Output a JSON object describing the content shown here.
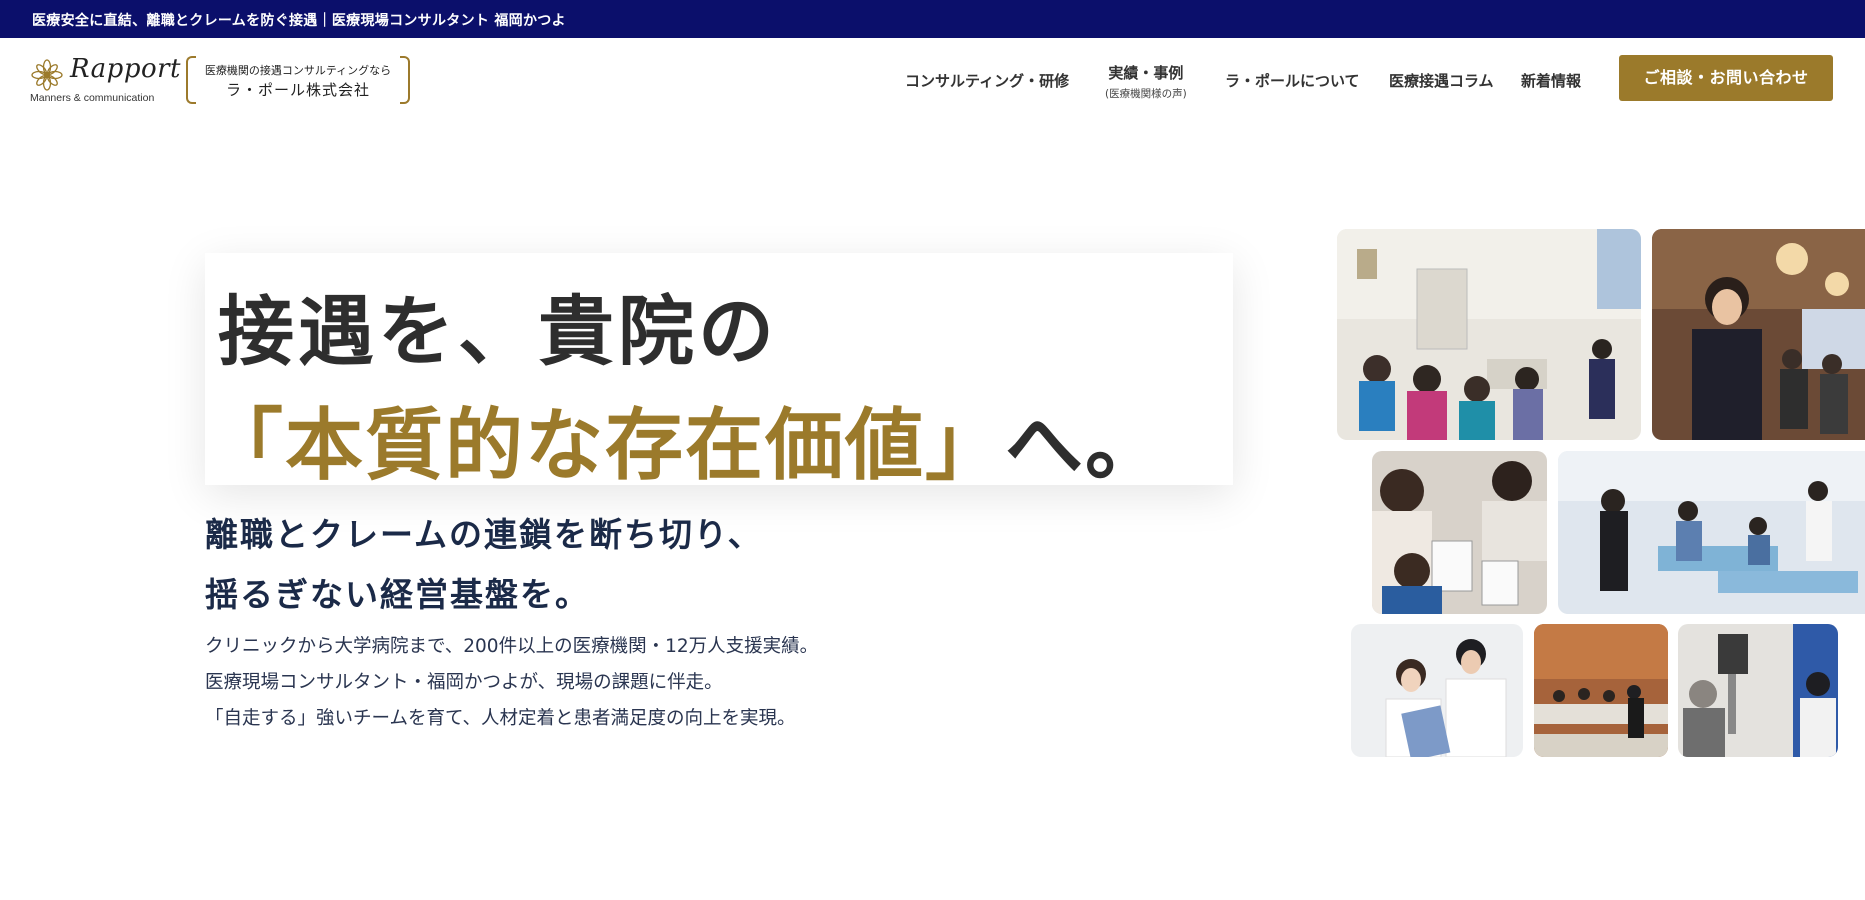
{
  "topbar": {
    "text": "医療安全に直結、離職とクレームを防ぐ接遇｜医療現場コンサルタント 福岡かつよ"
  },
  "header": {
    "logo": {
      "word": "Rapport",
      "tagline": "Manners & communication"
    },
    "company": {
      "sub": "医療機関の接遇コンサルティングなら",
      "name": "ラ・ポール株式会社"
    },
    "nav": [
      {
        "label": "コンサルティング・研修"
      },
      {
        "label": "実績・事例",
        "sub": "(医療機関様の声)"
      },
      {
        "label": "ラ・ポールについて"
      },
      {
        "label": "医療接遇コラム"
      },
      {
        "label": "新着情報"
      }
    ],
    "cta": "ご相談・お問い合わせ"
  },
  "hero": {
    "line1": "接遇を、貴院の",
    "line2_gold": "「本質的な存在価値」",
    "line2_dark": "へ。",
    "sub1": "離職とクレームの連鎖を断ち切り、",
    "sub2": "揺るぎない経営基盤を。",
    "body": [
      "クリニックから大学病院まで、200件以上の医療機関・12万人支援実績。",
      "医療現場コンサルタント・福岡かつよが、現場の課題に伴走。",
      "「自走する」強いチームを育て、人材定着と患者満足度の向上を実現。"
    ]
  },
  "colors": {
    "topbar": "#0b0f6b",
    "gold": "#9b7a2b",
    "heading": "#2e2e2e",
    "subheading": "#1b2a48"
  },
  "photos": [
    {
      "name": "seminar-photo"
    },
    {
      "name": "speaker-photo"
    },
    {
      "name": "workshop-photo"
    },
    {
      "name": "training-photo"
    },
    {
      "name": "clinic-consult-photo"
    },
    {
      "name": "classroom-photo"
    },
    {
      "name": "reception-photo"
    }
  ]
}
